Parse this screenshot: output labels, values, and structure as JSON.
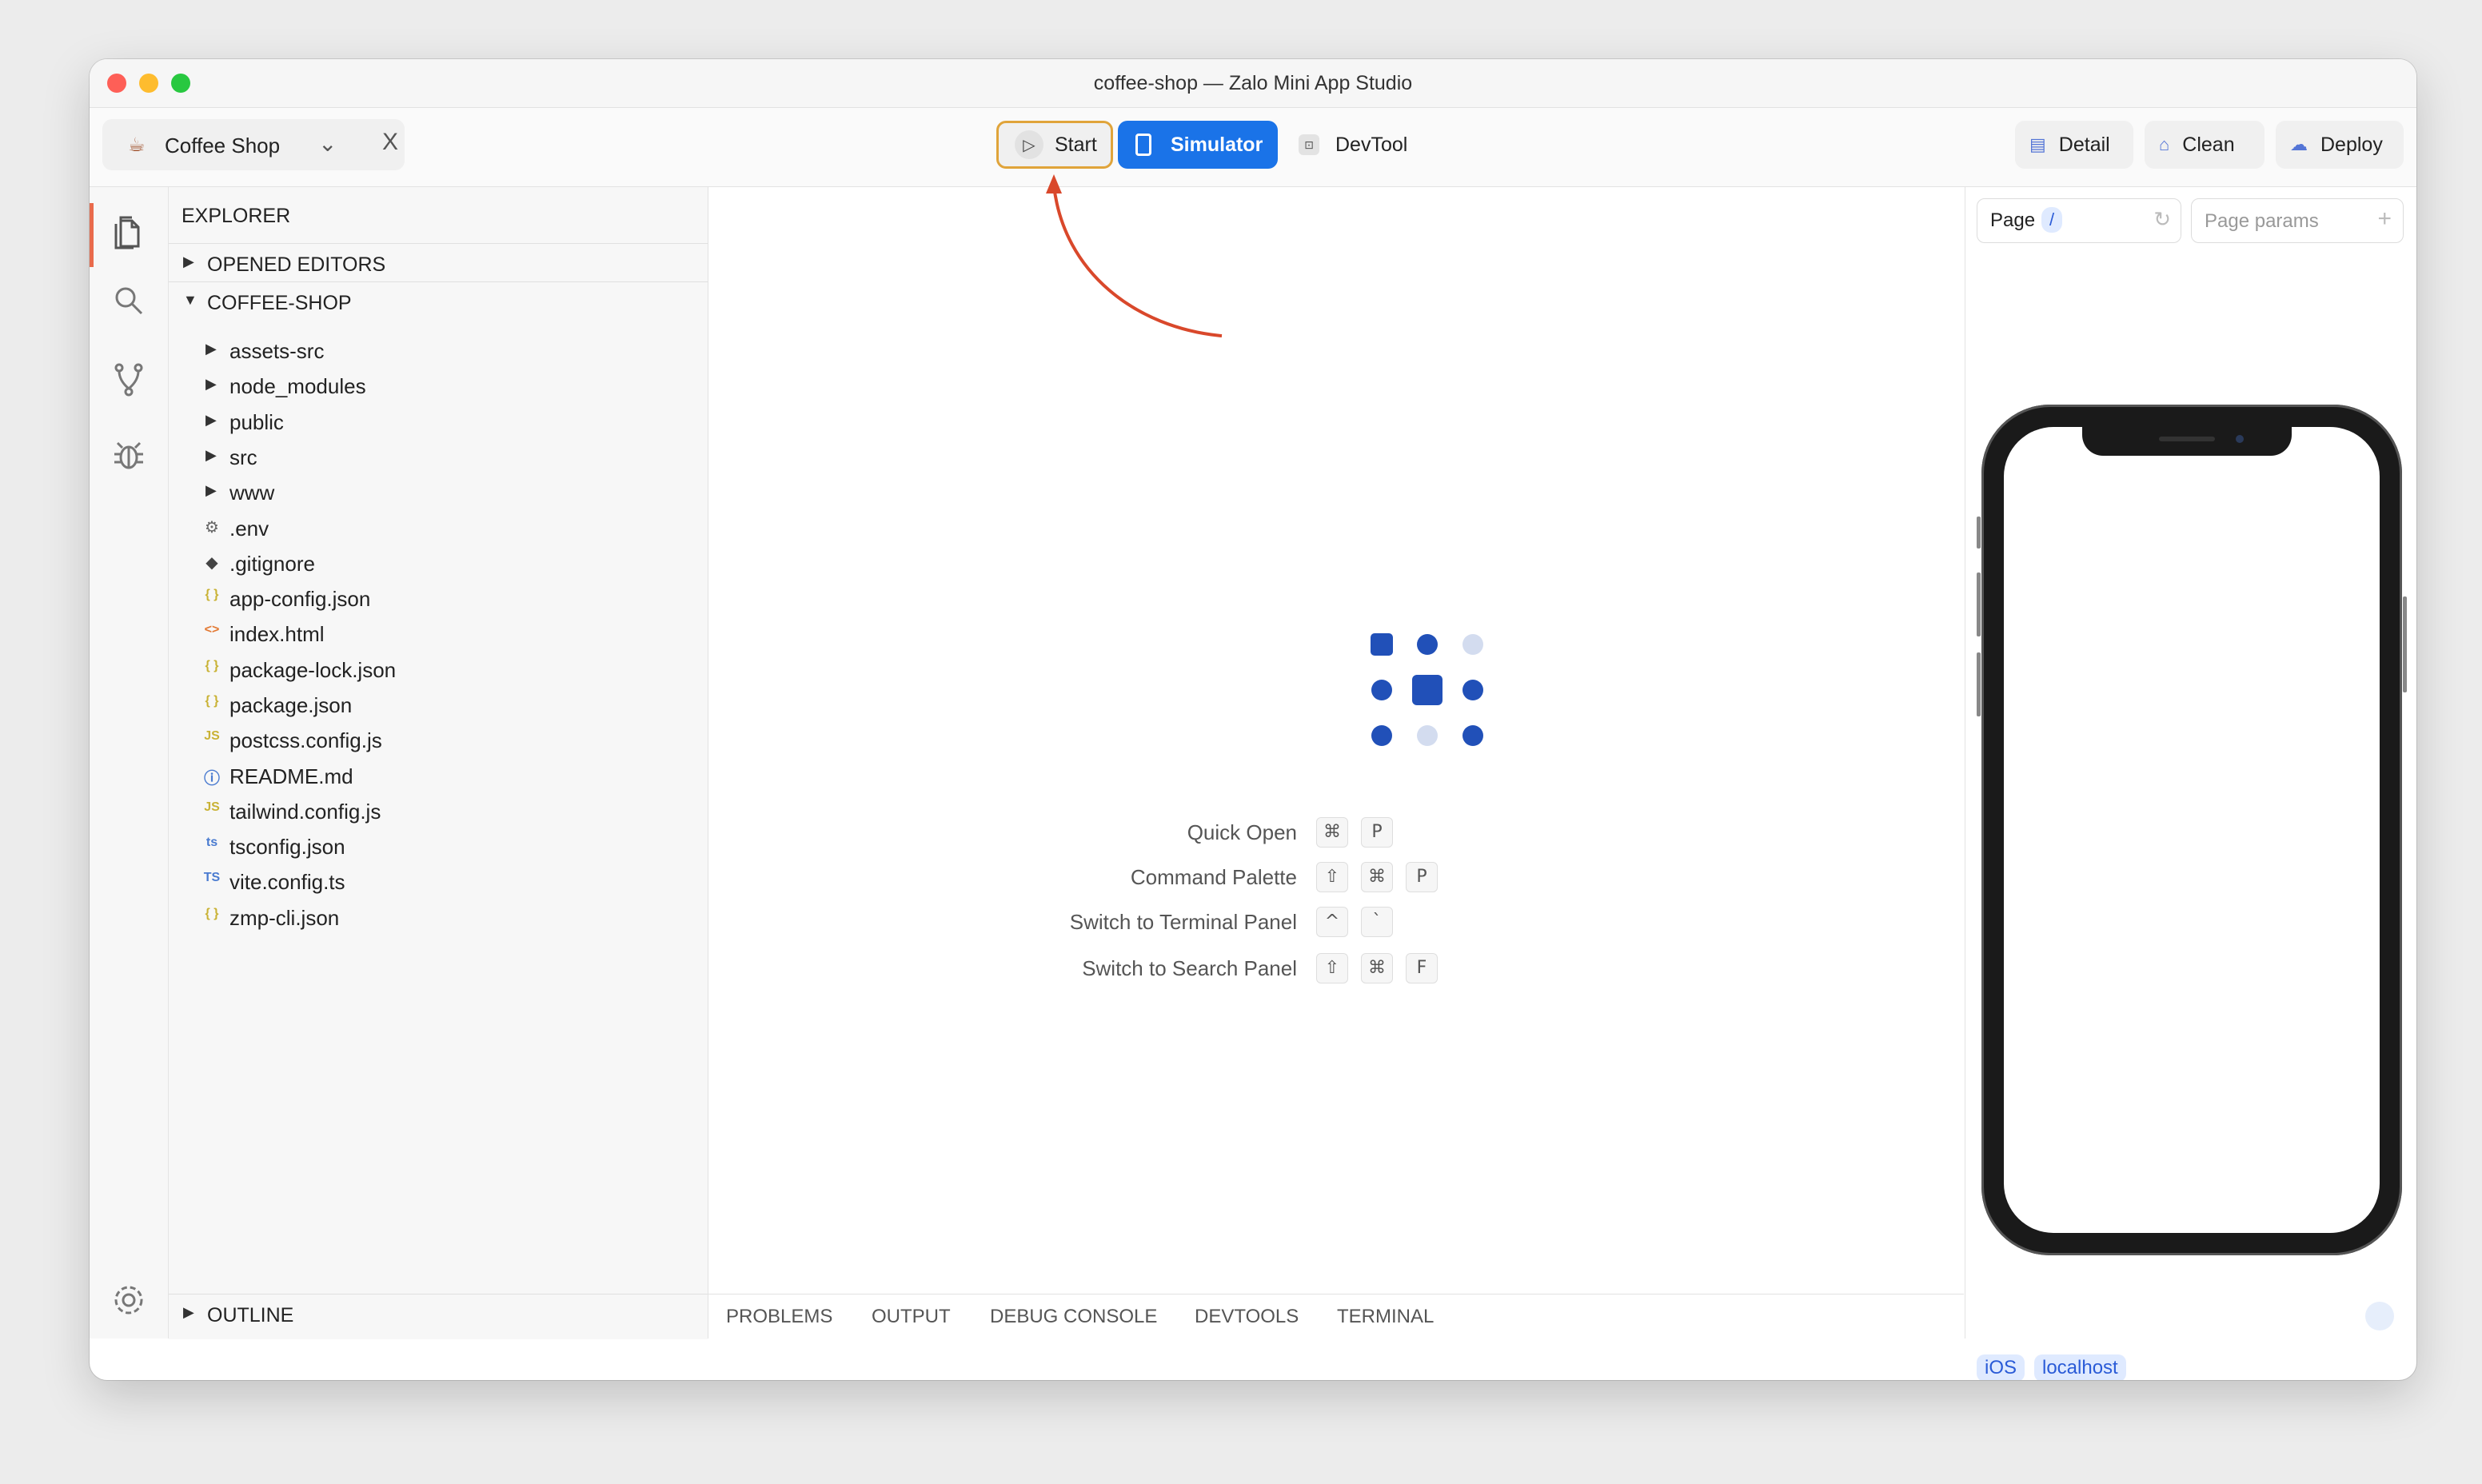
{
  "window": {
    "title": "coffee-shop — Zalo Mini App Studio"
  },
  "toolbar": {
    "project_name": "Coffee Shop",
    "close_symbol": "X",
    "start_label": "Start",
    "simulator_label": "Simulator",
    "devtool_label": "DevTool",
    "detail_label": "Detail",
    "clean_label": "Clean",
    "deploy_label": "Deploy"
  },
  "explorer": {
    "header": "EXPLORER",
    "opened_editors": "OPENED EDITORS",
    "project_folder": "COFFEE-SHOP",
    "folders": [
      "assets-src",
      "node_modules",
      "public",
      "src",
      "www"
    ],
    "files": [
      {
        "name": ".env",
        "icon": "⚙",
        "icon_color": "#666666"
      },
      {
        "name": ".gitignore",
        "icon": "◆",
        "icon_color": "#444444"
      },
      {
        "name": "app-config.json",
        "icon": "{ }",
        "icon_color": "#c9b235"
      },
      {
        "name": "index.html",
        "icon": "<>",
        "icon_color": "#e37933"
      },
      {
        "name": "package-lock.json",
        "icon": "{ }",
        "icon_color": "#c9b235"
      },
      {
        "name": "package.json",
        "icon": "{ }",
        "icon_color": "#c9b235"
      },
      {
        "name": "postcss.config.js",
        "icon": "JS",
        "icon_color": "#c9b235"
      },
      {
        "name": "README.md",
        "icon": "ⓘ",
        "icon_color": "#4a7bd0"
      },
      {
        "name": "tailwind.config.js",
        "icon": "JS",
        "icon_color": "#c9b235"
      },
      {
        "name": "tsconfig.json",
        "icon": "ts",
        "icon_color": "#4a7bd0"
      },
      {
        "name": "vite.config.ts",
        "icon": "TS",
        "icon_color": "#4a7bd0"
      },
      {
        "name": "zmp-cli.json",
        "icon": "{ }",
        "icon_color": "#c9b235"
      }
    ],
    "outline": "OUTLINE"
  },
  "editor": {
    "shortcuts": [
      {
        "label": "Quick Open",
        "keys": [
          "⌘",
          "P"
        ]
      },
      {
        "label": "Command Palette",
        "keys": [
          "⇧",
          "⌘",
          "P"
        ]
      },
      {
        "label": "Switch to Terminal Panel",
        "keys": [
          "^",
          "`"
        ]
      },
      {
        "label": "Switch to Search Panel",
        "keys": [
          "⇧",
          "⌘",
          "F"
        ]
      }
    ]
  },
  "panel": {
    "tabs": [
      "PROBLEMS",
      "OUTPUT",
      "DEBUG CONSOLE",
      "DEVTOOLS",
      "TERMINAL"
    ]
  },
  "simulator": {
    "page_label": "Page",
    "page_path": "/",
    "params_placeholder": "Page params",
    "platform": "iOS",
    "host": "localhost"
  },
  "colors": {
    "accent": "#1a73e8",
    "start_highlight": "#e0a43a",
    "annotation_arrow": "#d9482b",
    "logo_dark": "#2150b8",
    "logo_light": "#d3dcef"
  },
  "icons": {
    "activity_bar": [
      "files-icon",
      "search-icon",
      "source-control-icon",
      "debug-icon",
      "settings-icon"
    ]
  }
}
